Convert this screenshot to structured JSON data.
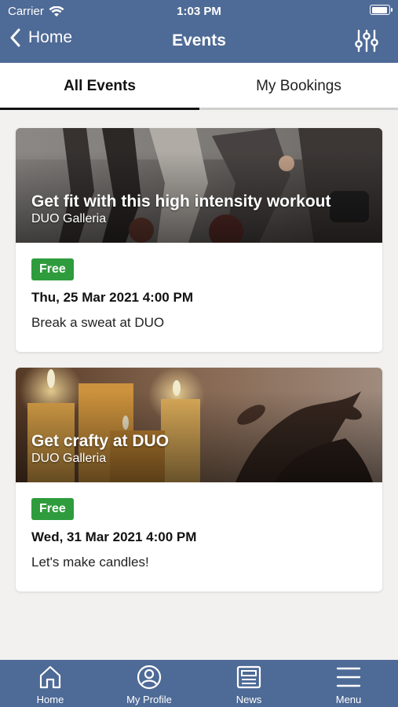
{
  "status_bar": {
    "carrier": "Carrier",
    "time": "1:03 PM"
  },
  "nav": {
    "back_label": "Home",
    "title": "Events"
  },
  "tabs": [
    {
      "label": "All Events",
      "active": true
    },
    {
      "label": "My Bookings",
      "active": false
    }
  ],
  "events": [
    {
      "title": "Get fit with this high intensity workout",
      "venue": "DUO Galleria",
      "price_badge": "Free",
      "datetime": "Thu, 25 Mar 2021 4:00 PM",
      "description": "Break a sweat at DUO",
      "image_subject": "fitness-class-photo"
    },
    {
      "title": "Get crafty at DUO",
      "venue": "DUO Galleria",
      "price_badge": "Free",
      "datetime": "Wed, 31 Mar 2021 4:00 PM",
      "description": "Let's make candles!",
      "image_subject": "candles-photo"
    }
  ],
  "bottom_nav": [
    {
      "label": "Home",
      "icon": "home-icon"
    },
    {
      "label": "My Profile",
      "icon": "profile-icon"
    },
    {
      "label": "News",
      "icon": "news-icon"
    },
    {
      "label": "Menu",
      "icon": "menu-icon"
    }
  ],
  "colors": {
    "brand": "#4e6a96",
    "badge": "#2e9c3c",
    "background": "#f2f1ef"
  }
}
